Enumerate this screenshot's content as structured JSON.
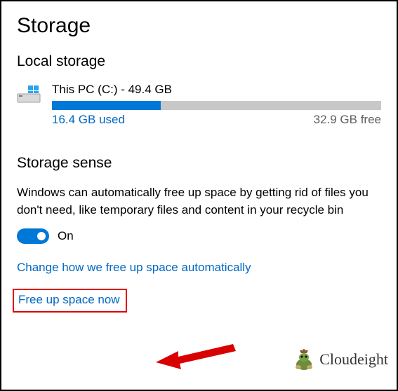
{
  "page_title": "Storage",
  "local_storage": {
    "heading": "Local storage",
    "drive": {
      "name": "This PC (C:) - 49.4 GB",
      "used_label": "16.4 GB used",
      "free_label": "32.9 GB free",
      "used_percent": 33
    }
  },
  "storage_sense": {
    "heading": "Storage sense",
    "description": "Windows can automatically free up space by getting rid of files you don't need, like temporary files and content in your recycle bin",
    "toggle_state": "On",
    "link_change": "Change how we free up space automatically",
    "link_free_up": "Free up space now"
  },
  "watermark": "Cloudeight",
  "chart_data": {
    "type": "bar",
    "title": "This PC (C:) - 49.4 GB",
    "categories": [
      "Used",
      "Free"
    ],
    "values": [
      16.4,
      32.9
    ],
    "unit": "GB",
    "total": 49.4
  }
}
